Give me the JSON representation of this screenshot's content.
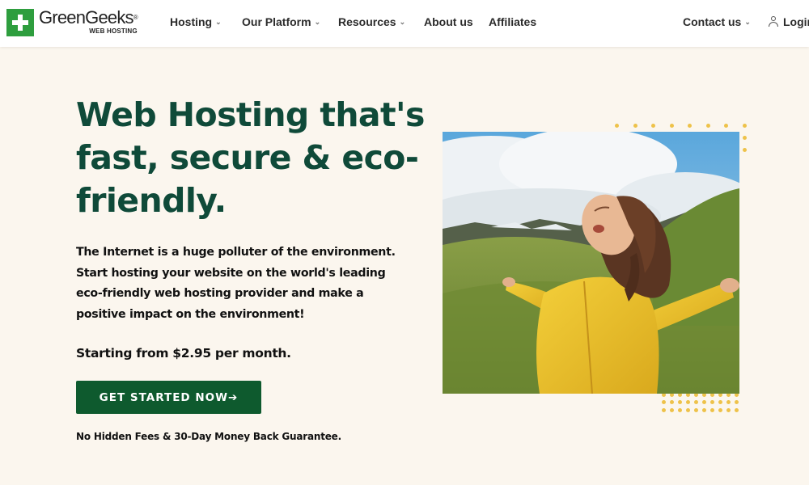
{
  "header": {
    "logo": {
      "name": "GreenGeeks",
      "registered": "®",
      "sub": "WEB HOSTING"
    },
    "nav": [
      {
        "label": "Hosting",
        "has_dropdown": true
      },
      {
        "label": "Our Platform",
        "has_dropdown": true
      },
      {
        "label": "Resources",
        "has_dropdown": true
      },
      {
        "label": "About us",
        "has_dropdown": false
      },
      {
        "label": "Affiliates",
        "has_dropdown": false
      }
    ],
    "contact": {
      "label": "Contact us",
      "has_dropdown": true
    },
    "login": {
      "label": "Login",
      "icon": "user-icon"
    }
  },
  "hero": {
    "title": "Web Hosting that's fast, secure & eco-friendly.",
    "description": "The Internet is a huge polluter of the environment. Start hosting your website on the world's leading eco-friendly web hosting provider and make a positive impact on the environment!",
    "price_text": "Starting from $2.95 per month.",
    "cta_label": "GET STARTED NOW",
    "cta_arrow": "➔",
    "guarantee": "No Hidden Fees & 30-Day Money Back Guarantee."
  },
  "colors": {
    "page_bg": "#fbf6ee",
    "heading": "#0f4a39",
    "cta_bg": "#0e5a2e",
    "logo_green": "#2e9e3e",
    "accent_dots": "#eec24a"
  }
}
